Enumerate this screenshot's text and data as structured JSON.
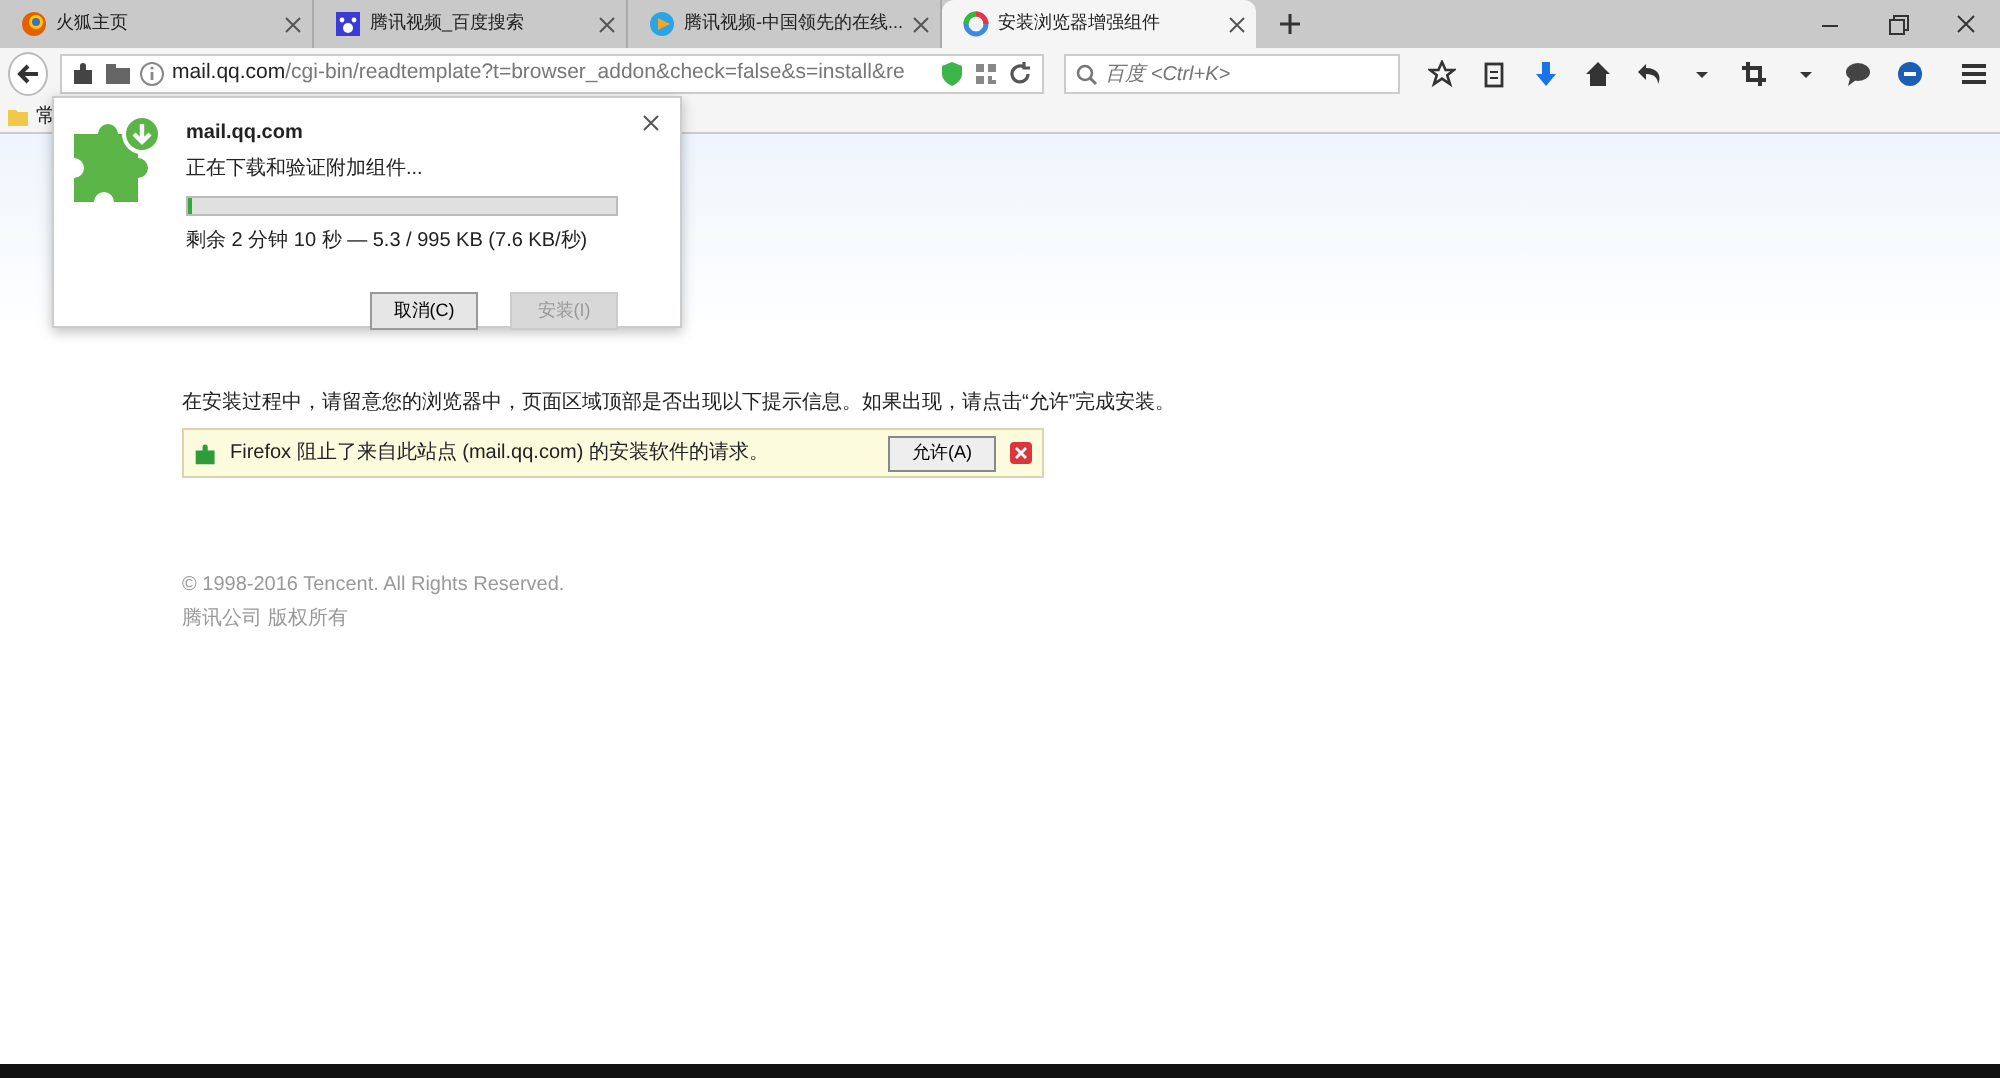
{
  "tabs": [
    {
      "title": "火狐主页",
      "selected": false
    },
    {
      "title": "腾讯视频_百度搜索",
      "selected": false
    },
    {
      "title": "腾讯视频-中国领先的在线...",
      "selected": false
    },
    {
      "title": "安装浏览器增强组件",
      "selected": true
    }
  ],
  "address": {
    "url": "mail.qq.com/cgi-bin/readtemplate?t=browser_addon&check=false&s=install&re"
  },
  "search": {
    "placeholder": "百度 <Ctrl+K>"
  },
  "bookmarks": [
    {
      "label": "常"
    }
  ],
  "popup": {
    "host": "mail.qq.com",
    "status": "正在下载和验证附加组件...",
    "level": 0.01,
    "progress_text": "剩余 2 分钟 10 秒 — 5.3 / 995 KB (7.6 KB/秒)",
    "buttons": [
      {
        "label": "取消(C)",
        "disabled": false
      },
      {
        "label": "安装(I)",
        "disabled": true
      }
    ]
  },
  "page": {
    "instruction": "在安装过程中，请留意您的浏览器中，页面区域顶部是否出现以下提示信息。如果出现，请点击“允许”完成安装。",
    "notice": {
      "text": "Firefox 阻止了来自此站点 (mail.qq.com) 的安装软件的请求。",
      "button": "允许(A)"
    },
    "footer": [
      "© 1998-2016 Tencent. All Rights Reserved.",
      "腾讯公司 版权所有"
    ]
  }
}
